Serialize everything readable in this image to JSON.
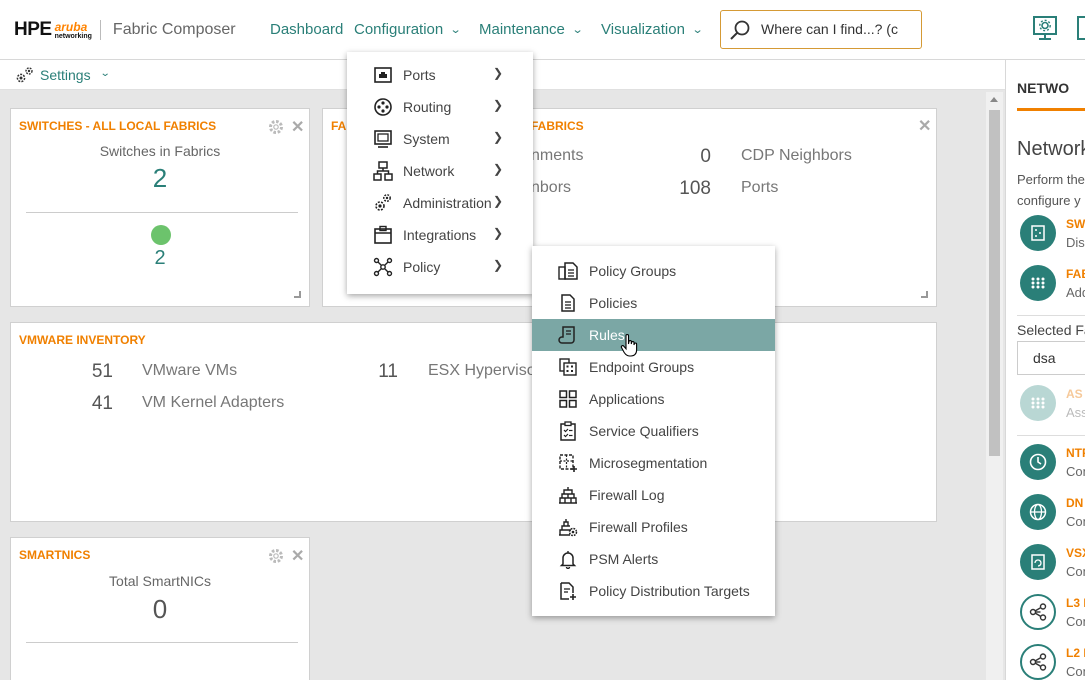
{
  "header": {
    "logo_hpe": "HPE",
    "logo_aruba": "aruba",
    "logo_networking": "networking",
    "app_title": "Fabric Composer",
    "nav": [
      {
        "label": "Dashboard",
        "has_dropdown": false
      },
      {
        "label": "Configuration",
        "has_dropdown": true
      },
      {
        "label": "Maintenance",
        "has_dropdown": true
      },
      {
        "label": "Visualization",
        "has_dropdown": true
      }
    ],
    "search_placeholder": "Where can I find...? (c"
  },
  "settings_bar": {
    "label": "Settings"
  },
  "panels": {
    "switches": {
      "title": "SWITCHES - ALL LOCAL FABRICS",
      "label": "Switches in Fabrics",
      "count": "2",
      "healthy_count": "2",
      "healthy_color": "#6cc36c"
    },
    "fabrics": {
      "title_left": "FA",
      "title_right": "FABRICS",
      "stats": [
        {
          "num": "",
          "label": "nments"
        },
        {
          "num": "0",
          "label": "CDP Neighbors"
        },
        {
          "num": "",
          "label": "nbors"
        },
        {
          "num": "108",
          "label": "Ports"
        }
      ]
    },
    "vmware": {
      "title": "VMWARE INVENTORY",
      "stats": [
        {
          "num": "51",
          "label": "VMware VMs"
        },
        {
          "num": "11",
          "label": "ESX Hyperviso"
        },
        {
          "num": "41",
          "label": "VM Kernel Adapters"
        }
      ]
    },
    "smartnics": {
      "title": "SMARTNICS",
      "label": "Total SmartNICs",
      "count": "0"
    }
  },
  "config_menu": {
    "items": [
      {
        "label": "Ports",
        "icon": "ports-icon"
      },
      {
        "label": "Routing",
        "icon": "routing-icon"
      },
      {
        "label": "System",
        "icon": "system-icon"
      },
      {
        "label": "Network",
        "icon": "network-icon"
      },
      {
        "label": "Administration",
        "icon": "administration-icon"
      },
      {
        "label": "Integrations",
        "icon": "integrations-icon"
      },
      {
        "label": "Policy",
        "icon": "policy-icon"
      }
    ]
  },
  "policy_menu": {
    "items": [
      {
        "label": "Policy Groups",
        "icon": "policy-groups-icon"
      },
      {
        "label": "Policies",
        "icon": "policies-icon"
      },
      {
        "label": "Rules",
        "icon": "rules-icon",
        "active": true
      },
      {
        "label": "Endpoint Groups",
        "icon": "endpoint-groups-icon"
      },
      {
        "label": "Applications",
        "icon": "applications-icon"
      },
      {
        "label": "Service Qualifiers",
        "icon": "service-qualifiers-icon"
      },
      {
        "label": "Microsegmentation",
        "icon": "microsegmentation-icon"
      },
      {
        "label": "Firewall Log",
        "icon": "firewall-log-icon"
      },
      {
        "label": "Firewall Profiles",
        "icon": "firewall-profiles-icon"
      },
      {
        "label": "PSM Alerts",
        "icon": "bell-icon"
      },
      {
        "label": "Policy Distribution Targets",
        "icon": "distribution-targets-icon"
      }
    ]
  },
  "right_panel": {
    "tab": "NETWO",
    "heading": "Network",
    "desc_1": "Perform the",
    "desc_2": "configure y",
    "items_top": [
      {
        "title": "SW",
        "sub": "Dis"
      },
      {
        "title": "FAB",
        "sub": "Add"
      }
    ],
    "selected_label": "Selected Fa",
    "selected_value": "dsa",
    "item_faded": {
      "title": "AS",
      "sub": "Ass"
    },
    "items_bottom": [
      {
        "title": "NTP",
        "sub": "Con"
      },
      {
        "title": "DN",
        "sub": "Con"
      },
      {
        "title": "VSX",
        "sub": "Con"
      },
      {
        "title": "L3 I",
        "sub": "Con"
      },
      {
        "title": "L2 I",
        "sub": "Con"
      }
    ]
  },
  "colors": {
    "accent": "#2a7f78",
    "orange": "#f08000",
    "active_menu_bg": "#7ba7a5"
  }
}
